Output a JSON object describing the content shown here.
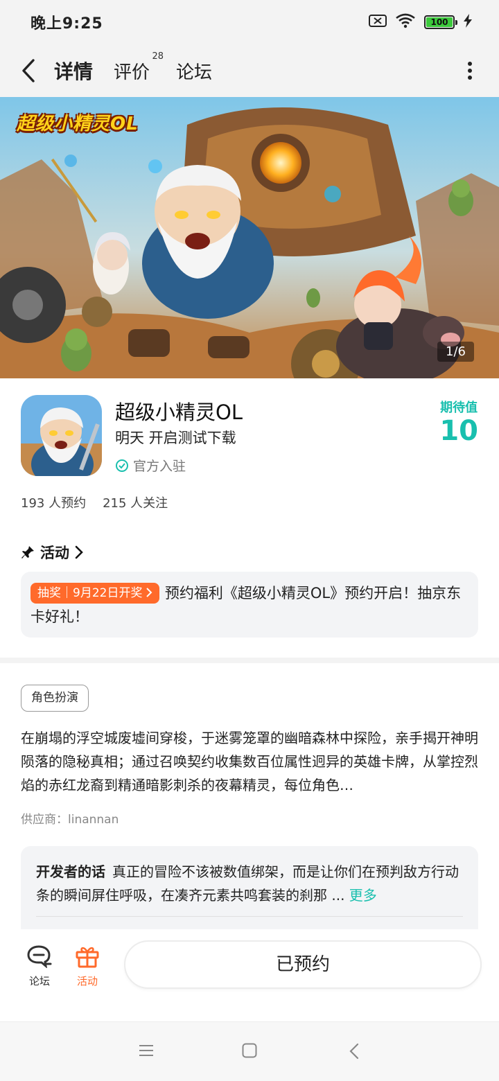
{
  "status_bar": {
    "time": "晚上9:25",
    "battery": "100"
  },
  "nav": {
    "tabs": [
      {
        "label": "详情"
      },
      {
        "label": "评价",
        "badge": "28"
      },
      {
        "label": "论坛"
      }
    ]
  },
  "banner": {
    "logo_text": "超级小精灵OL",
    "counter": "1/6"
  },
  "game": {
    "title": "超级小精灵OL",
    "subtitle": "明天 开启测试下载",
    "official": "官方入驻",
    "expect_label": "期待值",
    "expect_value": "10"
  },
  "stats": {
    "reservations": "193 人预约",
    "followers": "215 人关注"
  },
  "activity": {
    "header": "活动",
    "tag": "抽奖｜9月22日开奖",
    "text": "预约福利《超级小精灵OL》预约开启！抽京东卡好礼！"
  },
  "genre_tag": "角色扮演",
  "description": "在崩塌的浮空城废墟间穿梭，于迷雾笼罩的幽暗森林中探险，亲手揭开神明陨落的隐秘真相；通过召唤契约收集数百位属性迥异的英雄卡牌，从掌控烈焰的赤红龙裔到精通暗影刺杀的夜幕精灵，每位角色…",
  "supplier": "供应商：linannan",
  "developer": {
    "label": "开发者的话",
    "text": "真正的冒险不该被数值绑架，而是让你们在预判敌方行动条的瞬间屏住呼吸，在凑齐元素共鸣套装的刹那 ...",
    "more": "更多"
  },
  "action_bar": {
    "forum_label": "论坛",
    "activity_label": "活动",
    "reserve_button": "已预约"
  },
  "colors": {
    "accent": "#19bfae",
    "orange": "#ff6a2b"
  }
}
